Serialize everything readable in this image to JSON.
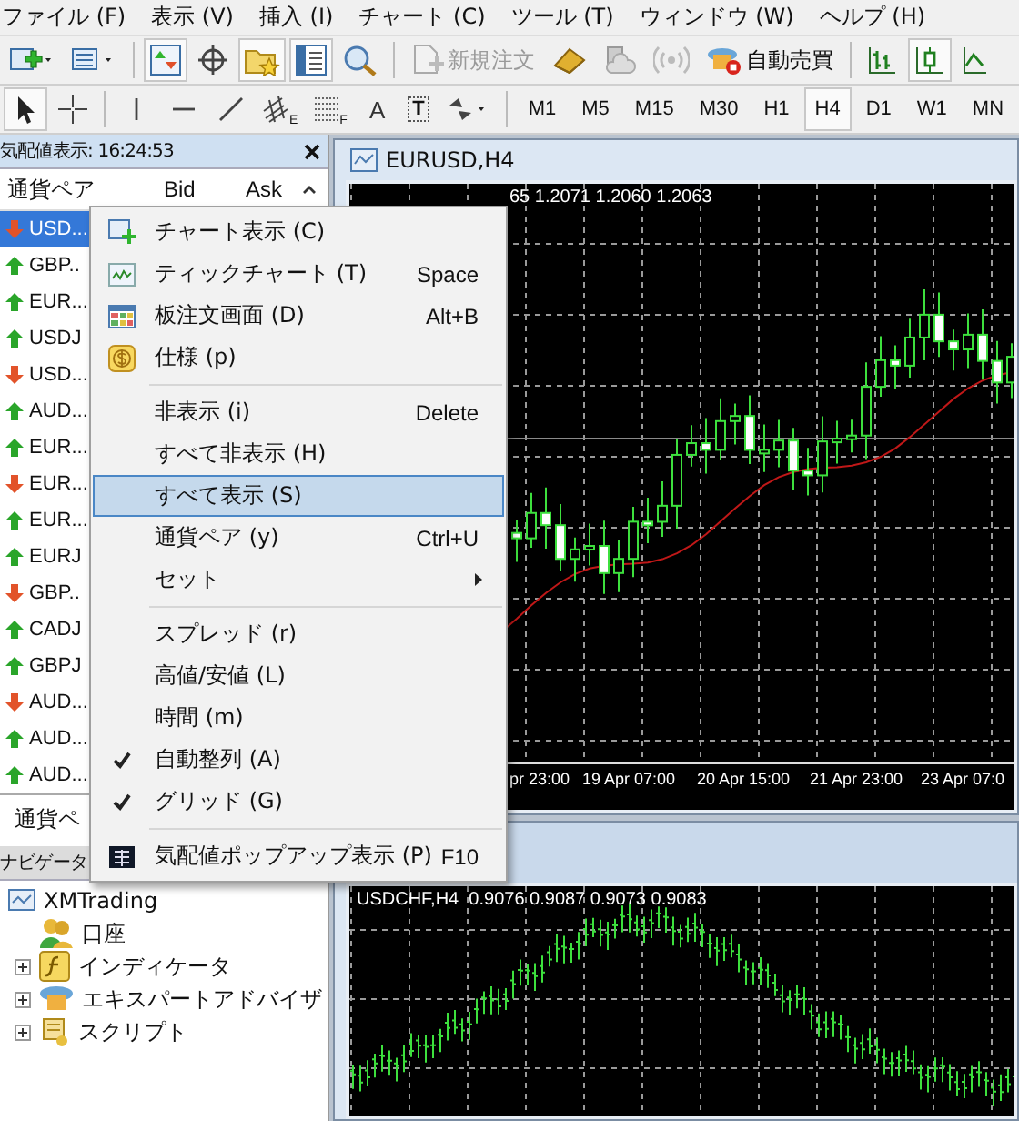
{
  "menu_bar": [
    "ファイル (F)",
    "表示 (V)",
    "挿入 (I)",
    "チャート (C)",
    "ツール (T)",
    "ウィンドウ (W)",
    "ヘルプ (H)"
  ],
  "toolbar": {
    "new_order": {
      "label": "新規注文",
      "disabled": true
    },
    "auto_trading": {
      "label": "自動売買",
      "disabled": false
    }
  },
  "drawing_tools": {
    "fibo_labels": [
      "E",
      "F"
    ],
    "text_tool": "A",
    "label_tool": "T"
  },
  "timeframes": [
    {
      "label": "M1",
      "selected": false
    },
    {
      "label": "M5",
      "selected": false
    },
    {
      "label": "M15",
      "selected": false
    },
    {
      "label": "M30",
      "selected": false
    },
    {
      "label": "H1",
      "selected": false
    },
    {
      "label": "H4",
      "selected": true
    },
    {
      "label": "D1",
      "selected": false
    },
    {
      "label": "W1",
      "selected": false
    },
    {
      "label": "MN",
      "selected": false
    }
  ],
  "market_watch": {
    "title": "気配値表示: 16:24:53",
    "columns": [
      "通貨ペア",
      "Bid",
      "Ask"
    ],
    "rows": [
      {
        "symbol": "USD...",
        "rising": false,
        "selected": true
      },
      {
        "symbol": "GBP..",
        "rising": true,
        "selected": false
      },
      {
        "symbol": "EUR...",
        "rising": true,
        "selected": false
      },
      {
        "symbol": "USDJ",
        "rising": true,
        "selected": false
      },
      {
        "symbol": "USD...",
        "rising": false,
        "selected": false
      },
      {
        "symbol": "AUD...",
        "rising": true,
        "selected": false
      },
      {
        "symbol": "EUR...",
        "rising": true,
        "selected": false
      },
      {
        "symbol": "EUR...",
        "rising": false,
        "selected": false
      },
      {
        "symbol": "EUR...",
        "rising": true,
        "selected": false
      },
      {
        "symbol": "EURJ",
        "rising": true,
        "selected": false
      },
      {
        "symbol": "GBP..",
        "rising": false,
        "selected": false
      },
      {
        "symbol": "CADJ",
        "rising": true,
        "selected": false
      },
      {
        "symbol": "GBPJ",
        "rising": true,
        "selected": false
      },
      {
        "symbol": "AUD...",
        "rising": false,
        "selected": false
      },
      {
        "symbol": "AUD...",
        "rising": true,
        "selected": false
      },
      {
        "symbol": "AUD...",
        "rising": true,
        "selected": false
      }
    ],
    "tab": "通貨ペ"
  },
  "navigator": {
    "title": "ナビゲータ",
    "tree": [
      {
        "label": "XMTrading",
        "children": [
          {
            "label": "口座",
            "expandable": false
          },
          {
            "label": "インディケータ",
            "expandable": true
          },
          {
            "label": "エキスパートアドバイザ",
            "expandable": true
          },
          {
            "label": "スクリプト",
            "expandable": true
          }
        ]
      }
    ]
  },
  "charts": [
    {
      "title": "EURUSD,H4",
      "kind": "candles",
      "info": "65 1.2071 1.2060 1.2063",
      "time_labels": [
        "pr 23:00",
        "19 Apr 07:00",
        "20 Apr 15:00",
        "21 Apr 23:00",
        "23 Apr 07:0"
      ]
    },
    {
      "kind": "bars",
      "info": "USDCHF,H4  0.9076 0.9087 0.9073 0.9083"
    }
  ],
  "context_menu": {
    "groups": [
      [
        {
          "label": "チャート表示 (C)",
          "checked": false,
          "selected": false,
          "submenu": false
        },
        {
          "label": "ティックチャート (T)",
          "shortcut": "Space",
          "checked": false,
          "selected": false,
          "submenu": false
        },
        {
          "label": "板注文画面 (D)",
          "shortcut": "Alt+B",
          "checked": false,
          "selected": false,
          "submenu": false
        },
        {
          "label": "仕様 (p)",
          "checked": false,
          "selected": false,
          "submenu": false
        }
      ],
      [
        {
          "label": "非表示 (i)",
          "shortcut": "Delete",
          "checked": false,
          "selected": false,
          "submenu": false
        },
        {
          "label": "すべて非表示 (H)",
          "checked": false,
          "selected": false,
          "submenu": false
        },
        {
          "label": "すべて表示 (S)",
          "checked": false,
          "selected": true,
          "submenu": false
        },
        {
          "label": "通貨ペア (y)",
          "shortcut": "Ctrl+U",
          "checked": false,
          "selected": false,
          "submenu": false
        },
        {
          "label": "セット",
          "checked": false,
          "selected": false,
          "submenu": true
        }
      ],
      [
        {
          "label": "スプレッド (r)",
          "checked": false,
          "selected": false,
          "submenu": false
        },
        {
          "label": "高値/安値 (L)",
          "checked": false,
          "selected": false,
          "submenu": false
        },
        {
          "label": "時間 (m)",
          "checked": false,
          "selected": false,
          "submenu": false
        },
        {
          "label": "自動整列 (A)",
          "checked": true,
          "selected": false,
          "submenu": false
        },
        {
          "label": "グリッド (G)",
          "checked": true,
          "selected": false,
          "submenu": false
        }
      ],
      [
        {
          "label": "気配値ポップアップ表示 (P)",
          "shortcut": "F10",
          "checked": false,
          "selected": false,
          "submenu": false
        }
      ]
    ]
  }
}
